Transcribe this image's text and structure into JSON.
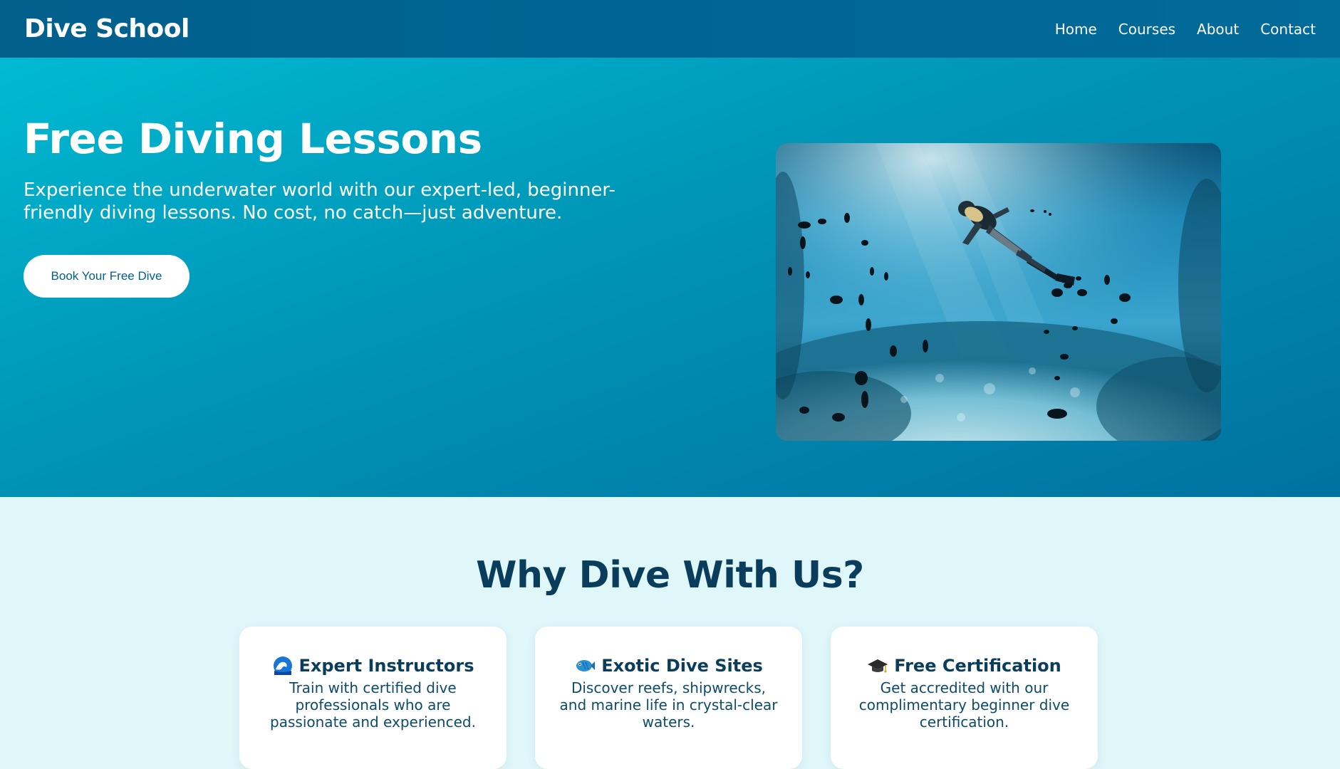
{
  "navbar": {
    "brand": "Dive School",
    "links": [
      "Home",
      "Courses",
      "About",
      "Contact"
    ]
  },
  "hero": {
    "title": "Free Diving Lessons",
    "subtitle": "Experience the underwater world with our expert-led, beginner-friendly diving lessons. No cost, no catch—just adventure.",
    "cta_label": "Book Your Free Dive"
  },
  "features": {
    "title": "Why Dive With Us?",
    "cards": [
      {
        "icon": "wave-icon",
        "title": "Expert Instructors",
        "text": "Train with certified dive professionals who are passionate and experienced."
      },
      {
        "icon": "fish-icon",
        "title": "Exotic Dive Sites",
        "text": "Discover reefs, shipwrecks, and marine life in crystal-clear waters."
      },
      {
        "icon": "graduation-cap-icon",
        "title": "Free Certification",
        "text": "Get accredited with our complimentary beginner dive certification."
      }
    ]
  },
  "colors": {
    "nav_bg": "#015f8c",
    "hero_gradient_start": "#00bad3",
    "hero_gradient_end": "#0071a0",
    "section_bg": "#e0f7fa",
    "heading_dark": "#0a3d5c"
  }
}
